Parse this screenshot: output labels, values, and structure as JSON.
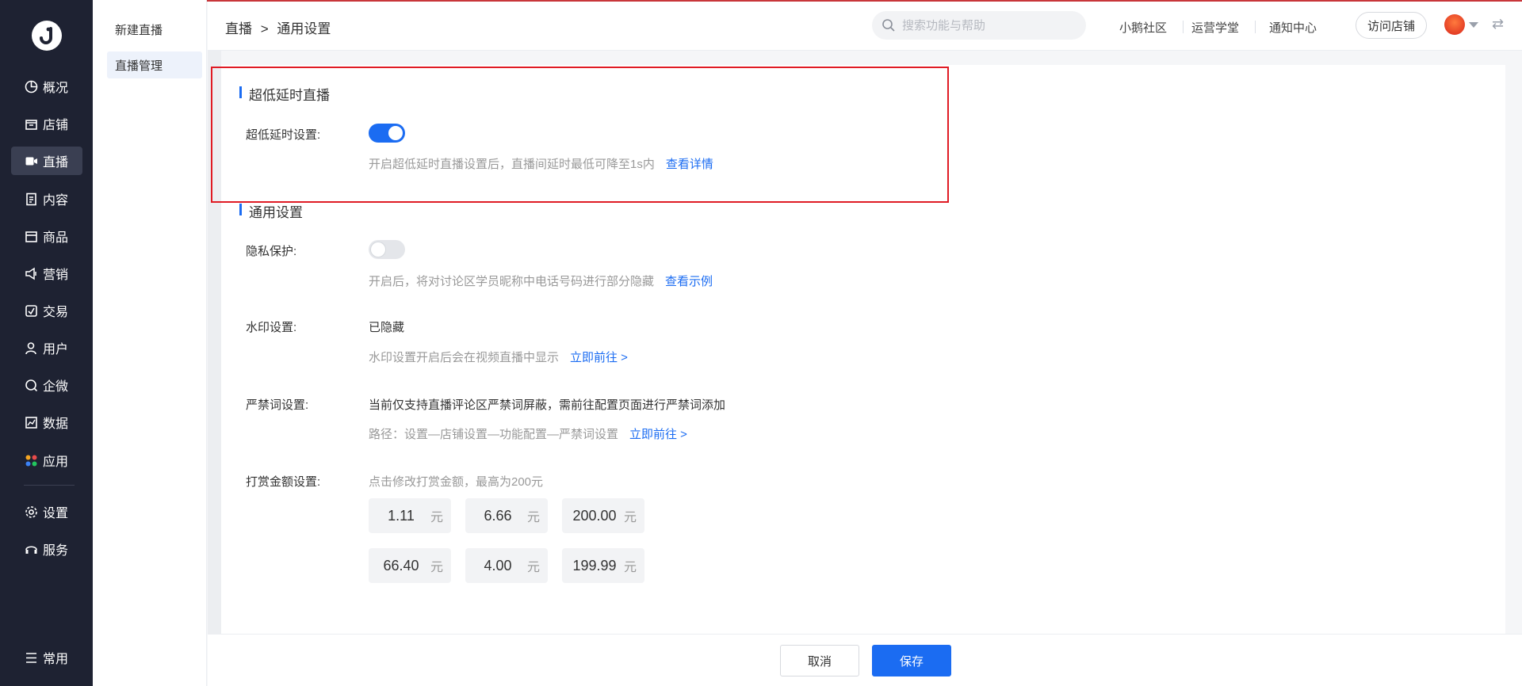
{
  "nav": {
    "items": [
      {
        "label": "概况",
        "icon": "overview-icon"
      },
      {
        "label": "店铺",
        "icon": "store-icon"
      },
      {
        "label": "直播",
        "icon": "live-icon"
      },
      {
        "label": "内容",
        "icon": "content-icon"
      },
      {
        "label": "商品",
        "icon": "goods-icon"
      },
      {
        "label": "营销",
        "icon": "marketing-icon"
      },
      {
        "label": "交易",
        "icon": "trade-icon"
      },
      {
        "label": "用户",
        "icon": "user-icon"
      },
      {
        "label": "企微",
        "icon": "wecom-icon"
      },
      {
        "label": "数据",
        "icon": "data-icon"
      },
      {
        "label": "应用",
        "icon": "apps-icon"
      },
      {
        "label": "设置",
        "icon": "settings-icon"
      },
      {
        "label": "服务",
        "icon": "service-icon"
      },
      {
        "label": "常用",
        "icon": "common-icon"
      }
    ],
    "active": "直播"
  },
  "subnav": {
    "items": [
      {
        "label": "新建直播"
      },
      {
        "label": "直播管理"
      }
    ]
  },
  "header": {
    "breadcrumb": [
      "直播",
      "通用设置"
    ],
    "breadcrumb_sep": ">",
    "search_placeholder": "搜索功能与帮助",
    "links": [
      "小鹅社区",
      "运营学堂",
      "通知中心"
    ],
    "visit_store": "访问店铺"
  },
  "low_latency": {
    "title": "超低延时直播",
    "label": "超低延时设置:",
    "enabled": true,
    "hint": "开启超低延时直播设置后，直播间延时最低可降至1s内",
    "link": "查看详情"
  },
  "general": {
    "title": "通用设置",
    "privacy": {
      "label": "隐私保护:",
      "enabled": false,
      "hint": "开启后，将对讨论区学员昵称中电话号码进行部分隐藏",
      "link": "查看示例"
    },
    "watermark": {
      "label": "水印设置:",
      "value": "已隐藏",
      "hint": "水印设置开启后会在视频直播中显示",
      "link": "立即前往 >"
    },
    "banned_words": {
      "label": "严禁词设置:",
      "value": "当前仅支持直播评论区严禁词屏蔽，需前往配置页面进行严禁词添加",
      "hint": "路径：设置—店铺设置—功能配置—严禁词设置",
      "link": "立即前往 >"
    },
    "reward": {
      "label": "打赏金额设置:",
      "hint": "点击修改打赏金额，最高为200元",
      "unit": "元",
      "amounts": [
        "1.11",
        "6.66",
        "200.00",
        "66.40",
        "4.00",
        "199.99"
      ]
    }
  },
  "footer": {
    "cancel": "取消",
    "save": "保存"
  },
  "colors": {
    "nav_bg": "#1e2232",
    "accent": "#1b6cf2",
    "highlight_border": "#e01b24"
  }
}
